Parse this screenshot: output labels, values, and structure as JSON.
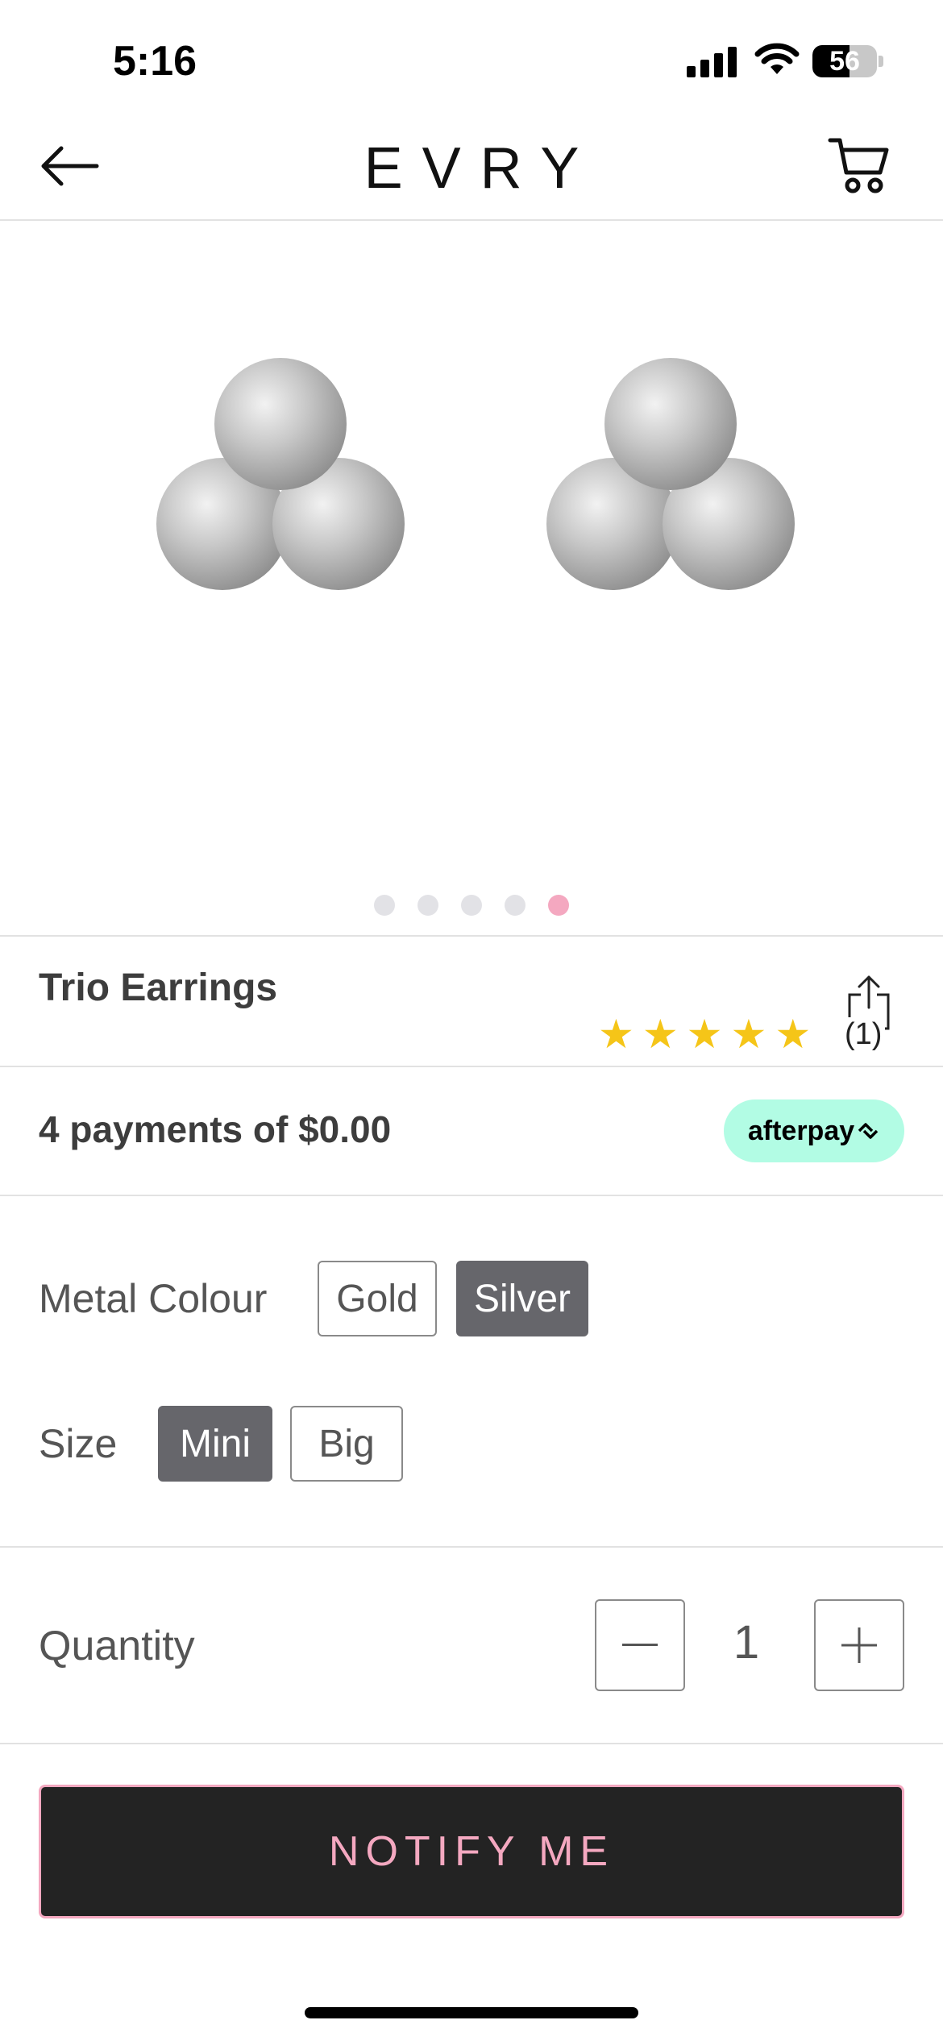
{
  "status_bar": {
    "time": "5:16",
    "battery": "56"
  },
  "nav": {
    "logo": "EVRY",
    "back_icon": "arrow-left-icon",
    "cart_icon": "cart-icon"
  },
  "carousel": {
    "image_alt": "Trio Earrings",
    "page_count": 5,
    "active_index": 4
  },
  "product": {
    "title": "Trio Earrings",
    "rating": 5,
    "stars": [
      "★",
      "★",
      "★",
      "★",
      "★"
    ],
    "review_count": "(1)",
    "share_icon": "share-icon"
  },
  "payment": {
    "installments": "4 payments of $0.00",
    "afterpay_label": "afterpay"
  },
  "options": {
    "metal_label": "Metal Colour",
    "metal_values": [
      "Gold",
      "Silver"
    ],
    "metal_selected": "Silver",
    "size_label": "Size",
    "size_values": [
      "Mini",
      "Big"
    ],
    "size_selected": "Mini"
  },
  "quantity": {
    "label": "Quantity",
    "value": "1",
    "minus": "−",
    "plus": "+"
  },
  "cta": {
    "notify_label": "NOTIFY ME"
  },
  "colors": {
    "accent_pink": "#f4a8c0",
    "star_yellow": "#f5c518",
    "afterpay_mint": "#b2fce4",
    "selected_grey": "#66666b",
    "cta_dark": "#232323"
  }
}
